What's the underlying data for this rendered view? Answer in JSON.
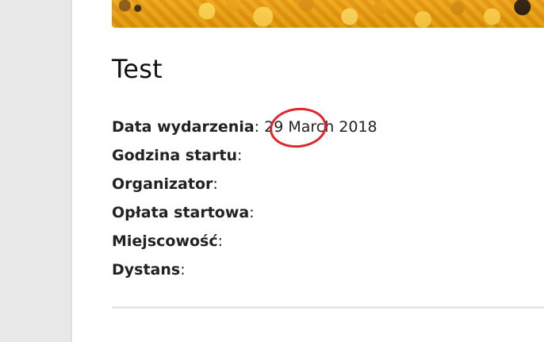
{
  "event": {
    "title": "Test",
    "fields": [
      {
        "label": "Data wydarzenia",
        "value": "29 March 2018"
      },
      {
        "label": "Godzina startu",
        "value": ""
      },
      {
        "label": "Organizator",
        "value": ""
      },
      {
        "label": "Opłata startowa",
        "value": ""
      },
      {
        "label": "Miejscowość",
        "value": ""
      },
      {
        "label": "Dystans",
        "value": ""
      }
    ]
  },
  "hero": {
    "icon": "hero-image"
  },
  "colors": {
    "page_background": "#e8e8e8",
    "content_background": "#ffffff",
    "annotation": "#e0262b"
  }
}
